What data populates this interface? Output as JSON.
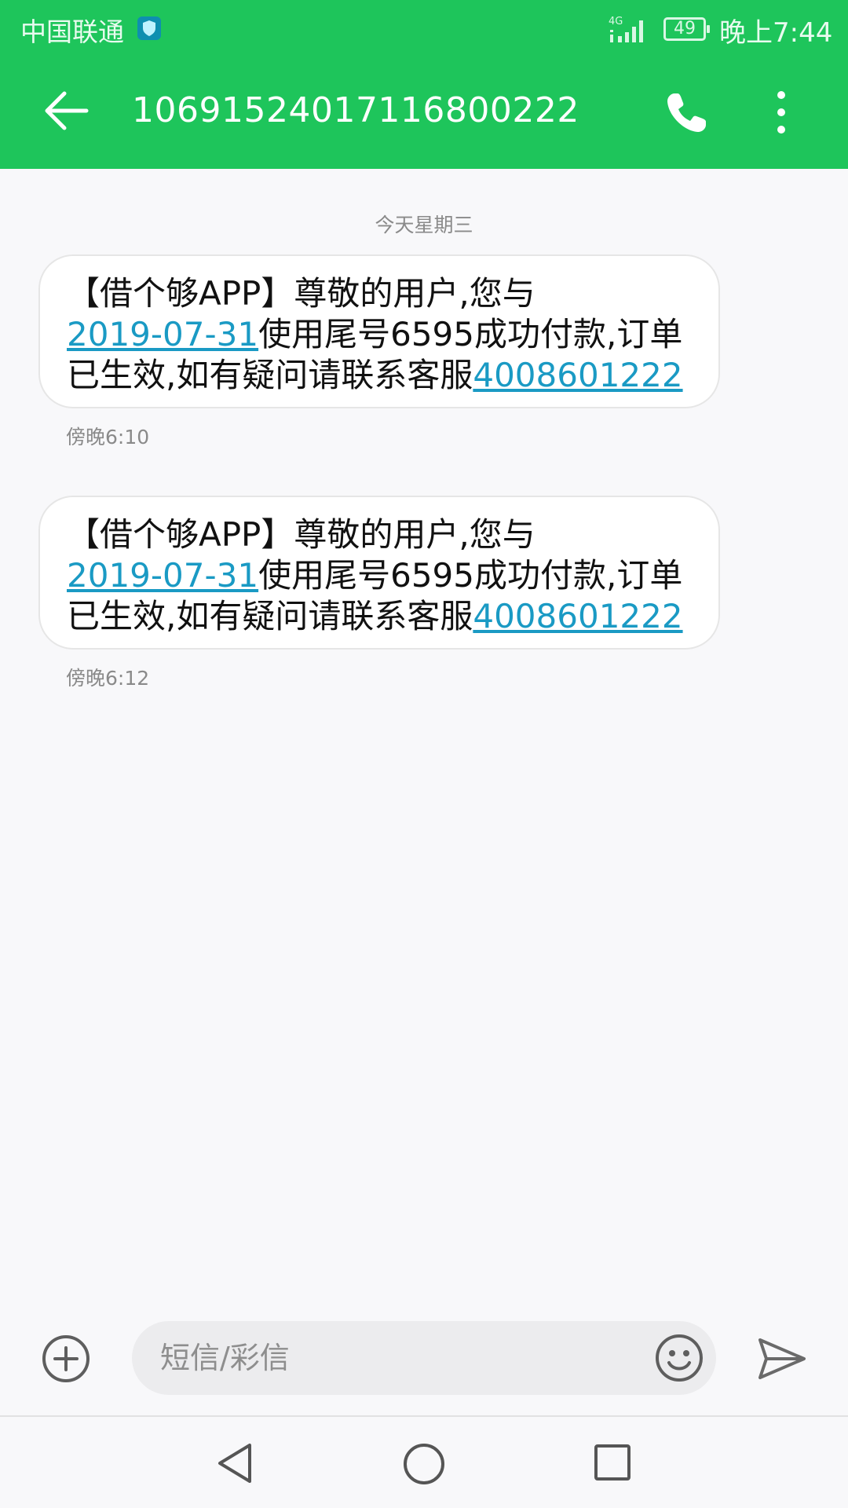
{
  "status_bar": {
    "carrier": "中国联通",
    "network": "4G",
    "battery": "49",
    "time": "晚上7:44"
  },
  "app_bar": {
    "title": "10691524017116800222",
    "back_icon": "arrow-left",
    "call_icon": "phone",
    "menu_icon": "more-vertical"
  },
  "conversation": {
    "date_separator": "今天星期三",
    "messages": [
      {
        "line1": "【借个够APP】尊敬的用户,您与",
        "date_link": "2019-07-31",
        "line2_rest": "使用尾号6595成功付款,订单",
        "line3_text": "已生效,如有疑问请联系客服",
        "phone_link": "4008601222",
        "time": "傍晚6:10"
      },
      {
        "line1": "【借个够APP】尊敬的用户,您与",
        "date_link": "2019-07-31",
        "line2_rest": "使用尾号6595成功付款,订单",
        "line3_text": "已生效,如有疑问请联系客服",
        "phone_link": "4008601222",
        "time": "傍晚6:12"
      }
    ]
  },
  "composer": {
    "placeholder": "短信/彩信",
    "add_icon": "plus-circle",
    "emoji_icon": "smiley",
    "send_icon": "send"
  },
  "nav_bar": {
    "back_icon": "triangle-back",
    "home_icon": "circle-home",
    "recents_icon": "square-recents"
  },
  "colors": {
    "accent": "#1ec55b",
    "link": "#1a9ac4"
  }
}
